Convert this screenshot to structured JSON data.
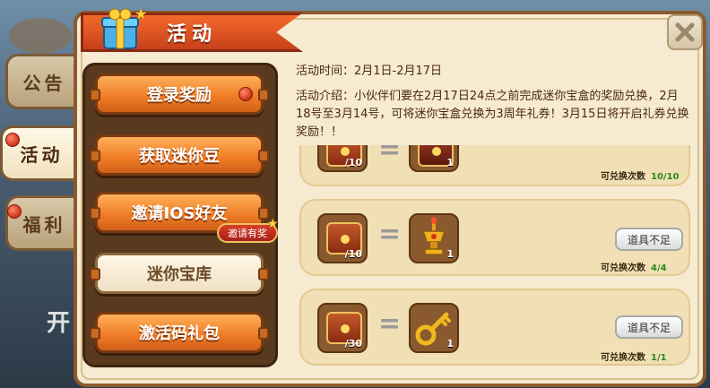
{
  "header": {
    "title": "活动"
  },
  "side_tabs": [
    {
      "label": "公告"
    },
    {
      "label": "活动"
    },
    {
      "label": "福利"
    }
  ],
  "background": {
    "partial_text": "开"
  },
  "menu": {
    "items": [
      {
        "label": "登录奖励"
      },
      {
        "label": "获取迷你豆"
      },
      {
        "label": "邀请IOS好友",
        "badge": "邀请有奖"
      },
      {
        "label": "迷你宝库"
      },
      {
        "label": "激活码礼包"
      }
    ]
  },
  "activity": {
    "time_text": "活动时间：2月1日-2月17日",
    "description_text": "活动介绍：小伙伴们要在2月17日24点之前完成迷你宝盒的奖励兑换，2月18号至3月14号，可将迷你宝盒兑换为3周年礼券！3月15日将开启礼券兑换奖励！！"
  },
  "exchanges": [
    {
      "cost_qty": "/10",
      "reward_qty": "1",
      "button_label": "",
      "count_label": "可兑换次数",
      "count_value": "10/10"
    },
    {
      "cost_qty": "/10",
      "reward_qty": "1",
      "button_label": "道具不足",
      "count_label": "可兑换次数",
      "count_value": "4/4"
    },
    {
      "cost_qty": "/30",
      "reward_qty": "1",
      "button_label": "道具不足",
      "count_label": "可兑换次数",
      "count_value": "1/1"
    }
  ],
  "icons": [
    "gift-icon",
    "close-icon",
    "treasure-chest-icon",
    "trophy-icon",
    "key-icon",
    "star-icon"
  ],
  "colors": {
    "accent": "#ee7a24",
    "panel": "#f6ead0",
    "count_green": "#2a8a1a"
  }
}
